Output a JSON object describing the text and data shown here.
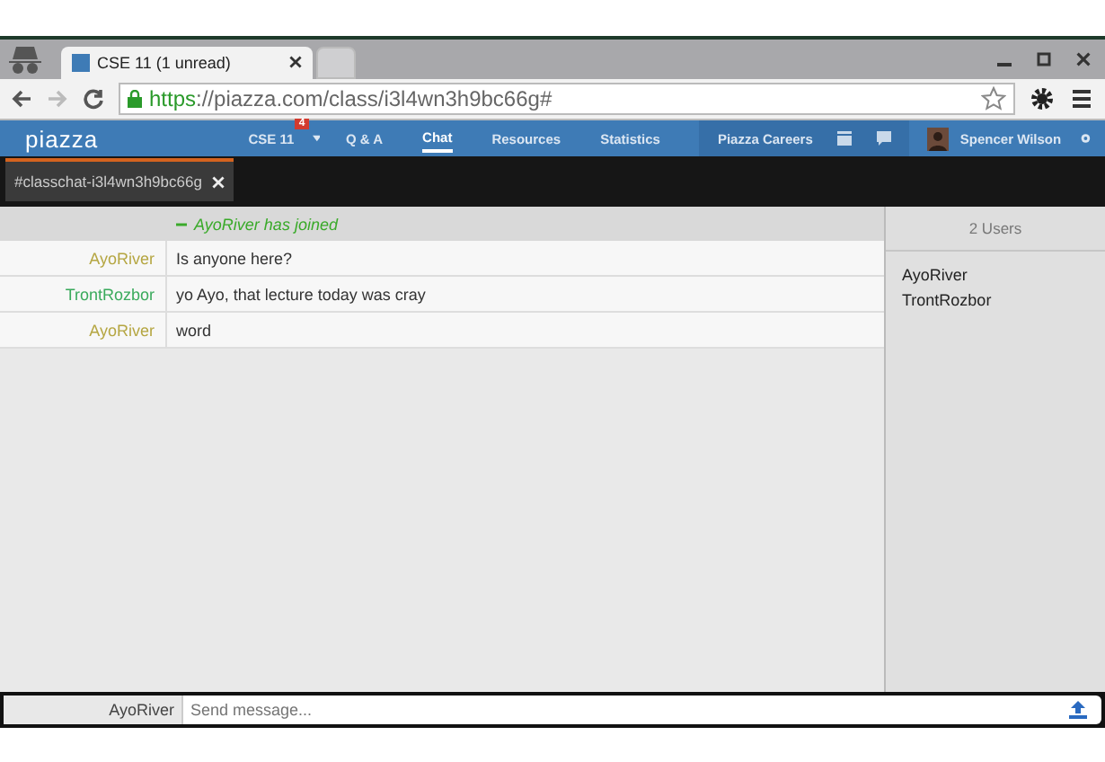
{
  "browser": {
    "tabs": [
      {
        "title": "CSE 11 (1 unread)",
        "selected": true
      },
      {
        "selected": false
      }
    ],
    "url": {
      "scheme": "https",
      "rest": "://piazza.com/class/i3l4wn3h9bc66g#"
    }
  },
  "nav": {
    "logo": "piazza",
    "course": "CSE 11",
    "badge": "4",
    "links": [
      {
        "label": "Q & A",
        "selected": false
      },
      {
        "label": "Chat",
        "selected": true
      },
      {
        "label": "Resources",
        "selected": false
      },
      {
        "label": "Statistics",
        "selected": false
      }
    ],
    "careers": "Piazza Careers",
    "user": "Spencer Wilson"
  },
  "channel_tab": {
    "label": "#classchat-i3l4wn3h9bc66g"
  },
  "messages": [
    {
      "kind": "system",
      "text": "AyoRiver has joined"
    },
    {
      "kind": "message",
      "author": "AyoRiver",
      "color": "#b5a642",
      "text": "Is anyone here?"
    },
    {
      "kind": "message",
      "author": "TrontRozbor",
      "color": "#3aaa5c",
      "text": "yo Ayo, that lecture today was cray"
    },
    {
      "kind": "message",
      "author": "AyoRiver",
      "color": "#b5a642",
      "text": "word"
    }
  ],
  "users": {
    "header": "2 Users",
    "names": [
      "AyoRiver",
      "TrontRozbor"
    ]
  },
  "composer": {
    "author": "AyoRiver",
    "placeholder": "Send message..."
  }
}
